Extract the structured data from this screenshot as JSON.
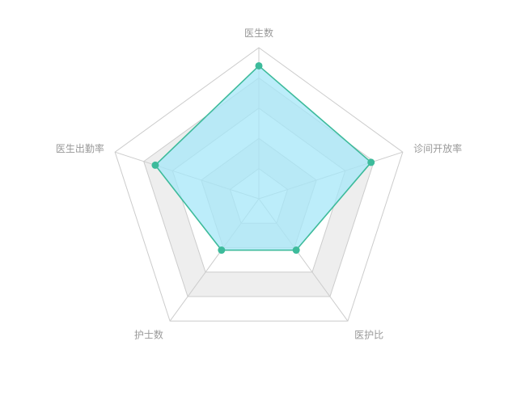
{
  "chart_data": {
    "type": "radar",
    "indicators": [
      "医生数",
      "诊间开放率",
      "医护比",
      "护士数",
      "医生出勤率"
    ],
    "max": 100,
    "levels": 5,
    "series": [
      {
        "values": [
          88,
          78,
          42,
          42,
          72
        ],
        "color": "#3dbb9b",
        "area_color": "#a6e7f8"
      }
    ],
    "split_area_colors": [
      "#ffffff",
      "#eeeeee"
    ],
    "grid_line_color": "#cccccc"
  }
}
